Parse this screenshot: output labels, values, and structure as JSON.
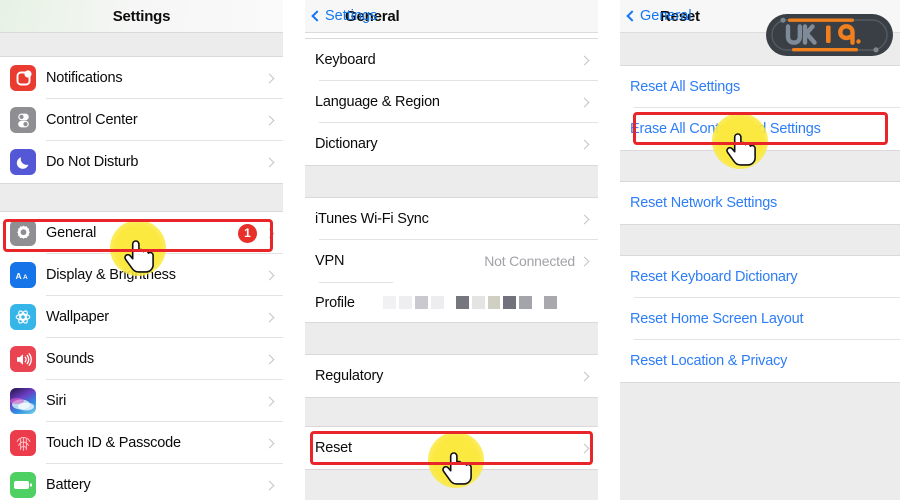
{
  "panels": {
    "settings": {
      "nav": {
        "title": "Settings"
      },
      "groups": [
        {
          "rows": [
            {
              "label": "Notifications",
              "icon": "notifications-icon",
              "accessory": "chevron"
            },
            {
              "label": "Control Center",
              "icon": "control-center-icon",
              "accessory": "chevron"
            },
            {
              "label": "Do Not Disturb",
              "icon": "do-not-disturb-icon",
              "accessory": "chevron"
            }
          ]
        },
        {
          "rows": [
            {
              "label": "General",
              "icon": "general-gear-icon",
              "accessory": "chevron",
              "badge": "1",
              "highlighted": true
            },
            {
              "label": "Display & Brightness",
              "icon": "display-brightness-icon",
              "accessory": "chevron"
            },
            {
              "label": "Wallpaper",
              "icon": "wallpaper-icon",
              "accessory": "chevron"
            },
            {
              "label": "Sounds",
              "icon": "sounds-icon",
              "accessory": "chevron"
            },
            {
              "label": "Siri",
              "icon": "siri-icon",
              "accessory": "chevron"
            },
            {
              "label": "Touch ID & Passcode",
              "icon": "touch-id-icon",
              "accessory": "chevron"
            },
            {
              "label": "Battery",
              "icon": "battery-icon",
              "accessory": "chevron"
            }
          ]
        }
      ]
    },
    "general": {
      "nav": {
        "back_label": "Settings",
        "title": "General"
      },
      "groups": [
        {
          "rows": [
            {
              "label": "Keyboard",
              "accessory": "chevron"
            },
            {
              "label": "Language & Region",
              "accessory": "chevron"
            },
            {
              "label": "Dictionary",
              "accessory": "chevron"
            }
          ]
        },
        {
          "rows": [
            {
              "label": "iTunes Wi-Fi Sync",
              "accessory": "chevron"
            },
            {
              "label": "VPN",
              "value": "Not Connected",
              "accessory": "chevron"
            },
            {
              "label": "Profile",
              "value_redacted": true
            }
          ]
        },
        {
          "rows": [
            {
              "label": "Regulatory",
              "accessory": "chevron"
            }
          ]
        },
        {
          "rows": [
            {
              "label": "Reset",
              "accessory": "chevron",
              "highlighted": true
            }
          ]
        }
      ]
    },
    "reset": {
      "nav": {
        "back_label": "General",
        "title": "Reset"
      },
      "groups": [
        {
          "rows": [
            {
              "label": "Reset All Settings",
              "style": "link"
            },
            {
              "label": "Erase All Content and Settings",
              "style": "link",
              "highlighted": true
            }
          ]
        },
        {
          "rows": [
            {
              "label": "Reset Network Settings",
              "style": "link"
            }
          ]
        },
        {
          "rows": [
            {
              "label": "Reset Keyboard Dictionary",
              "style": "link"
            },
            {
              "label": "Reset Home Screen Layout",
              "style": "link"
            },
            {
              "label": "Reset Location & Privacy",
              "style": "link"
            }
          ]
        }
      ]
    }
  },
  "annotations": {
    "highlight_color": "#e8262a",
    "tap_glow_color": "#fbe93f",
    "taps": [
      {
        "target": "general-row",
        "name": "tap-indicator-general"
      },
      {
        "target": "reset-row",
        "name": "tap-indicator-reset"
      },
      {
        "target": "erase-all-content-and-settings-row",
        "name": "tap-indicator-erase"
      }
    ]
  },
  "watermark": {
    "text": "UK19",
    "accent_color": "#f0801e",
    "body_color": "#3a3f45"
  }
}
